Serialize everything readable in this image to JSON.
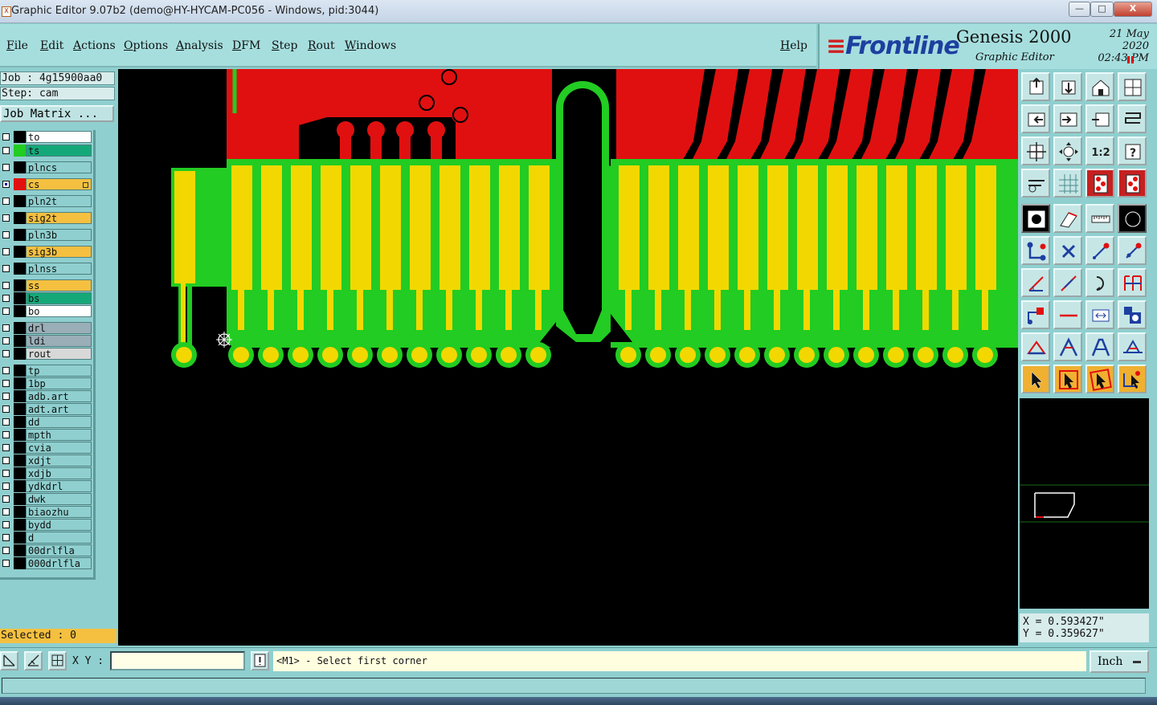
{
  "window": {
    "title": "Graphic Editor 9.07b2 (demo@HY-HYCAM-PC056 - Windows, pid:3044)",
    "controls": [
      "minimize",
      "maximize",
      "close"
    ]
  },
  "menu": {
    "items": [
      "File",
      "Edit",
      "Actions",
      "Options",
      "Analysis",
      "DFM",
      "Step",
      "Rout",
      "Windows"
    ],
    "help": "Help"
  },
  "brand": {
    "logo": "Frontline",
    "product": "Genesis 2000",
    "subtitle": "Graphic Editor",
    "date": "21 May 2020",
    "time": "02:43 PM"
  },
  "job": {
    "job_text": "Job : 4g15900aa0",
    "step_text": "Step: cam",
    "matrix_button": "Job Matrix ..."
  },
  "layers": [
    {
      "name": "to",
      "color": "#ffffff",
      "indicator": "#000000",
      "checked": false
    },
    {
      "name": "ts",
      "color": "#14a878",
      "indicator": "#22cc22",
      "checked": false
    },
    {
      "name": "plncs",
      "color": "#8fcfcf",
      "indicator": "#000000",
      "checked": false
    },
    {
      "name": "cs",
      "color": "#f5c040",
      "indicator": "#e01010",
      "checked": true
    },
    {
      "name": "pln2t",
      "color": "#8fcfcf",
      "indicator": "#000000",
      "checked": false
    },
    {
      "name": "sig2t",
      "color": "#f5c040",
      "indicator": "#000000",
      "checked": false
    },
    {
      "name": "pln3b",
      "color": "#8fcfcf",
      "indicator": "#000000",
      "checked": false
    },
    {
      "name": "sig3b",
      "color": "#f5c040",
      "indicator": "#000000",
      "checked": false
    },
    {
      "name": "plnss",
      "color": "#8fcfcf",
      "indicator": "#000000",
      "checked": false
    },
    {
      "name": "ss",
      "color": "#f5c040",
      "indicator": "#000000",
      "checked": false
    },
    {
      "name": "bs",
      "color": "#14a878",
      "indicator": "#000000",
      "checked": false
    },
    {
      "name": "bo",
      "color": "#ffffff",
      "indicator": "#000000",
      "checked": false
    },
    {
      "name": "drl",
      "color": "#9aaeb8",
      "indicator": "#000000",
      "checked": false
    },
    {
      "name": "ldi",
      "color": "#9aaeb8",
      "indicator": "#000000",
      "checked": false
    },
    {
      "name": "rout",
      "color": "#d8d8d8",
      "indicator": "#000000",
      "checked": false
    },
    {
      "name": "tp",
      "color": "#8fcfcf",
      "indicator": "#000000",
      "checked": false
    },
    {
      "name": "1bp",
      "color": "#8fcfcf",
      "indicator": "#000000",
      "checked": false
    },
    {
      "name": "adb.art",
      "color": "#8fcfcf",
      "indicator": "#000000",
      "checked": false
    },
    {
      "name": "adt.art",
      "color": "#8fcfcf",
      "indicator": "#000000",
      "checked": false
    },
    {
      "name": "dd",
      "color": "#8fcfcf",
      "indicator": "#000000",
      "checked": false
    },
    {
      "name": "mpth",
      "color": "#8fcfcf",
      "indicator": "#000000",
      "checked": false
    },
    {
      "name": "cvia",
      "color": "#8fcfcf",
      "indicator": "#000000",
      "checked": false
    },
    {
      "name": "xdjt",
      "color": "#8fcfcf",
      "indicator": "#000000",
      "checked": false
    },
    {
      "name": "xdjb",
      "color": "#8fcfcf",
      "indicator": "#000000",
      "checked": false
    },
    {
      "name": "ydkdrl",
      "color": "#8fcfcf",
      "indicator": "#000000",
      "checked": false
    },
    {
      "name": "dwk",
      "color": "#8fcfcf",
      "indicator": "#000000",
      "checked": false
    },
    {
      "name": "biaozhu",
      "color": "#8fcfcf",
      "indicator": "#000000",
      "checked": false
    },
    {
      "name": "bydd",
      "color": "#8fcfcf",
      "indicator": "#000000",
      "checked": false
    },
    {
      "name": "d",
      "color": "#8fcfcf",
      "indicator": "#000000",
      "checked": false
    },
    {
      "name": "00drlfla",
      "color": "#8fcfcf",
      "indicator": "#000000",
      "checked": false
    },
    {
      "name": "000drlfla",
      "color": "#8fcfcf",
      "indicator": "#000000",
      "checked": false
    }
  ],
  "selected_text": "Selected : 0",
  "toolbox": {
    "view_tools": [
      "zoom-in-icon",
      "zoom-out-icon",
      "home-view-icon",
      "redraw-icon",
      "pan-left-icon",
      "pan-right-icon",
      "zoom-width-icon",
      "snake-icon",
      "fit-icon",
      "center-icon",
      "scale-1-2-icon",
      "query-icon",
      "measure-icon",
      "grid-icon",
      "layer-red-a-icon",
      "layer-red-b-icon"
    ],
    "one_to_one_label": "1:2",
    "edit_tools": [
      "select-feature-icon",
      "move-icon",
      "ruler-icon",
      "point-icon",
      "connect-icon",
      "cut-icon",
      "arc-icon",
      "connect-point-icon",
      "line-angle-icon",
      "line-diag-icon",
      "undo-arc-icon",
      "mirror-icon",
      "snap-icon",
      "segment-icon",
      "measure-pad-icon",
      "group-icon",
      "arc-fill-icon",
      "corner-a-icon",
      "corner-b-icon",
      "corner-c-icon",
      "pointer-icon",
      "pointer-box-icon",
      "pointer-edit-icon",
      "pointer-multi-icon"
    ]
  },
  "coords": {
    "x": "X = 0.593427\"",
    "y": "Y = 0.359627\""
  },
  "bottombar": {
    "xy_label": "X Y :",
    "xy_value": "",
    "prompt": "<M1> - Select first corner",
    "unit": "Inch"
  },
  "board": {
    "copper_color": "#e01010",
    "finger_color": "#f2d800",
    "mask_color": "#22cc22",
    "background": "#000000",
    "left_finger_count": 11,
    "right_finger_count": 13
  }
}
